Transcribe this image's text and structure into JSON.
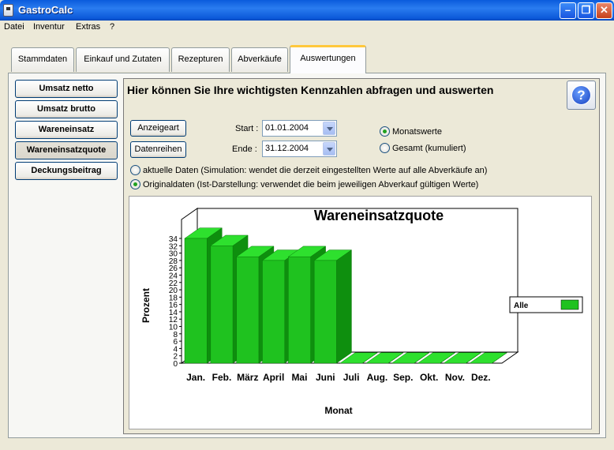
{
  "window": {
    "title": "GastroCalc"
  },
  "menu": [
    "Datei",
    "Inventur",
    "Extras",
    "?"
  ],
  "tabs": [
    "Stammdaten",
    "Einkauf und Zutaten",
    "Rezepturen",
    "Abverkäufe",
    "Auswertungen"
  ],
  "active_tab": "Auswertungen",
  "sidebar": [
    "Umsatz netto",
    "Umsatz brutto",
    "Wareneinsatz",
    "Wareneinsatzquote",
    "Deckungsbeitrag"
  ],
  "active_sidebar": "Wareneinsatzquote",
  "heading": "Hier können Sie Ihre wichtigsten Kennzahlen abfragen und auswerten",
  "controls": {
    "anzeigeart": "Anzeigeart",
    "datenreihen": "Datenreihen",
    "start_label": "Start :",
    "start_value": "01.01.2004",
    "ende_label": "Ende :",
    "ende_value": "31.12.2004",
    "monatswerte": "Monatswerte",
    "gesamt": "Gesamt (kumuliert)",
    "aktuelle_daten": "aktuelle Daten (Simulation: wendet die derzeit eingestellten Werte auf alle Abverkäufe an)",
    "originaldaten": "Originaldaten (Ist-Darstellung: verwendet die beim jeweiligen Abverkauf gültigen Werte)",
    "selected_period": "Monatswerte",
    "selected_data": "Originaldaten"
  },
  "chart_data": {
    "type": "bar",
    "title": "Wareneinsatzquote",
    "xlabel": "Monat",
    "ylabel": "Prozent",
    "ylim": [
      0,
      34
    ],
    "yticks": [
      0,
      2,
      4,
      6,
      8,
      10,
      12,
      14,
      16,
      18,
      20,
      22,
      24,
      26,
      28,
      30,
      32,
      34
    ],
    "categories": [
      "Jan.",
      "Feb.",
      "März",
      "April",
      "Mai",
      "Juni",
      "Juli",
      "Aug.",
      "Sep.",
      "Okt.",
      "Nov.",
      "Dez."
    ],
    "series": [
      {
        "name": "Alle",
        "values": [
          34,
          32,
          29,
          28,
          29,
          28,
          0,
          0,
          0,
          0,
          0,
          0
        ],
        "color": "#1fc21f"
      }
    ],
    "legend_position": "right",
    "grid": false
  }
}
